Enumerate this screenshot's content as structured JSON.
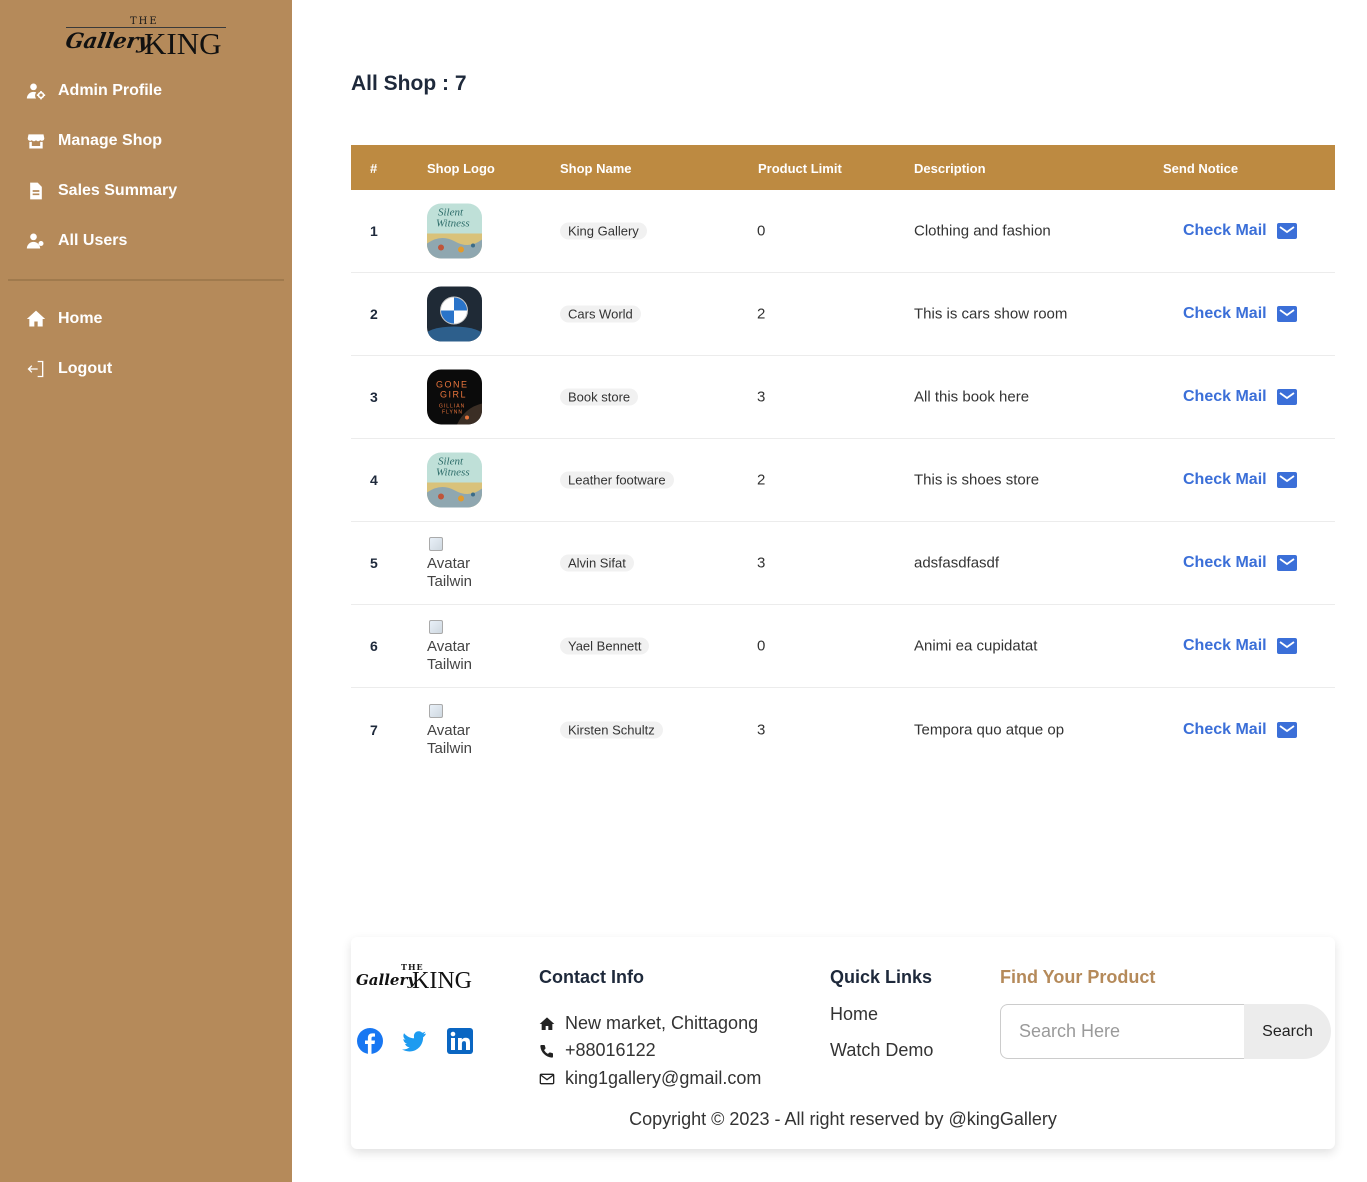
{
  "brand": {
    "the": "THE",
    "gallery": "Gallery",
    "king": "KING"
  },
  "sidebar": {
    "items": [
      {
        "label": "Admin Profile",
        "icon": "user-gear-icon"
      },
      {
        "label": "Manage Shop",
        "icon": "store-icon"
      },
      {
        "label": "Sales Summary",
        "icon": "file-icon"
      },
      {
        "label": "All Users",
        "icon": "users-icon"
      },
      {
        "label": "Home",
        "icon": "home-icon"
      },
      {
        "label": "Logout",
        "icon": "logout-icon"
      }
    ]
  },
  "main": {
    "title": "All Shop : 7",
    "table": {
      "headers": [
        "#",
        "Shop Logo",
        "Shop Name",
        "Product Limit",
        "Description",
        "Send Notice"
      ],
      "rows": [
        {
          "idx": "1",
          "logo": "silent-witness",
          "name": "King Gallery",
          "limit": "0",
          "desc": "Clothing and fashion",
          "notice": "Check Mail"
        },
        {
          "idx": "2",
          "logo": "bmw",
          "name": "Cars World",
          "limit": "2",
          "desc": "This is cars show room",
          "notice": "Check Mail"
        },
        {
          "idx": "3",
          "logo": "gone-girl",
          "name": "Book store",
          "limit": "3",
          "desc": "All this book here",
          "notice": "Check Mail"
        },
        {
          "idx": "4",
          "logo": "silent-witness",
          "name": "Leather footware",
          "limit": "2",
          "desc": "This is shoes store",
          "notice": "Check Mail"
        },
        {
          "idx": "5",
          "logo": "broken",
          "logo_alt": "Avatar Tailwin",
          "name": "Alvin Sifat",
          "limit": "3",
          "desc": "adsfasdfasdf",
          "notice": "Check Mail"
        },
        {
          "idx": "6",
          "logo": "broken",
          "logo_alt": "Avatar Tailwin",
          "name": "Yael Bennett",
          "limit": "0",
          "desc": "Animi ea cupidatat",
          "notice": "Check Mail"
        },
        {
          "idx": "7",
          "logo": "broken",
          "logo_alt": "Avatar Tailwin",
          "name": "Kirsten Schultz",
          "limit": "3",
          "desc": "Tempora quo atque op",
          "notice": "Check Mail"
        }
      ]
    }
  },
  "footer": {
    "contact_title": "Contact Info",
    "address": "New market, Chittagong",
    "phone": "+88016122",
    "email": "king1gallery@gmail.com",
    "quick_title": "Quick Links",
    "quick_links": [
      "Home",
      "Watch Demo"
    ],
    "find_title": "Find Your Product",
    "search_placeholder": "Search Here",
    "search_button": "Search",
    "copyright": "Copyright © 2023 - All right reserved by @kingGallery",
    "social": [
      "facebook-icon",
      "twitter-icon",
      "linkedin-icon"
    ]
  },
  "colors": {
    "sidebar_bg": "#b58a5a",
    "table_header_bg": "#bd8a41",
    "link_blue": "#3b6fd8",
    "find_title": "#b58a5a"
  }
}
